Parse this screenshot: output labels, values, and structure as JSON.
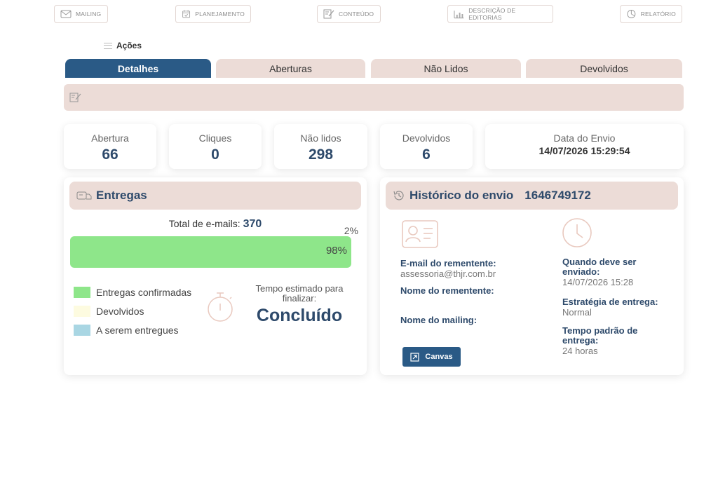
{
  "nav": [
    {
      "label": "MAILING",
      "icon": "mail-icon"
    },
    {
      "label": "PLANEJAMENTO",
      "icon": "calendar-icon"
    },
    {
      "label": "CONTEÚDO",
      "icon": "edit-icon"
    },
    {
      "label": "DESCRIÇÃO DE EDITORIAS",
      "icon": "chart-icon"
    },
    {
      "label": "RELATÓRIO",
      "icon": "pie-chart-icon"
    }
  ],
  "actions_label": "Ações",
  "tabs": [
    {
      "label": "Detalhes",
      "active": true
    },
    {
      "label": "Aberturas",
      "active": false
    },
    {
      "label": "Não Lidos",
      "active": false
    },
    {
      "label": "Devolvidos",
      "active": false
    }
  ],
  "stats": {
    "abertura": {
      "label": "Abertura",
      "value": "66"
    },
    "cliques": {
      "label": "Cliques",
      "value": "0"
    },
    "nao_lidos": {
      "label": "Não lidos",
      "value": "298"
    },
    "devolvidos": {
      "label": "Devolvidos",
      "value": "6"
    },
    "data_envio": {
      "label": "Data do Envio",
      "value": "14/07/2026 15:29:54"
    }
  },
  "entregas": {
    "title": "Entregas",
    "total_label": "Total de e-mails:",
    "total_value": "370",
    "remaining_pct_label": "2%",
    "delivered_pct_label": "98%",
    "delivered_fraction": 0.98,
    "legend": [
      {
        "label": "Entregas confirmadas",
        "color": "#8ee68a"
      },
      {
        "label": "Devolvidos",
        "color": "#fdfbe0"
      },
      {
        "label": "A serem entregues",
        "color": "#a9d6e3"
      }
    ],
    "tempo_label": "Tempo estimado para finalizar:",
    "tempo_value": "Concluído"
  },
  "historico": {
    "title": "Histórico do envio",
    "id": "1646749172",
    "email_label": "E-mail do rementente:",
    "email_value": "assessoria@thjr.com.br",
    "nome_rem_label": "Nome do rementente:",
    "nome_mailing_label": "Nome do mailing:",
    "canvas_label": "Canvas",
    "quando_label": "Quando deve ser enviado:",
    "quando_value": "14/07/2026 15:28",
    "estrategia_label": "Estratégia de entrega:",
    "estrategia_value": "Normal",
    "tempo_padrao_label": "Tempo padrão de entrega:",
    "tempo_padrao_value": "24 horas"
  },
  "colors": {
    "primary": "#2a5a86",
    "accent_bg": "#ecdcd7",
    "success": "#8ee68a"
  }
}
